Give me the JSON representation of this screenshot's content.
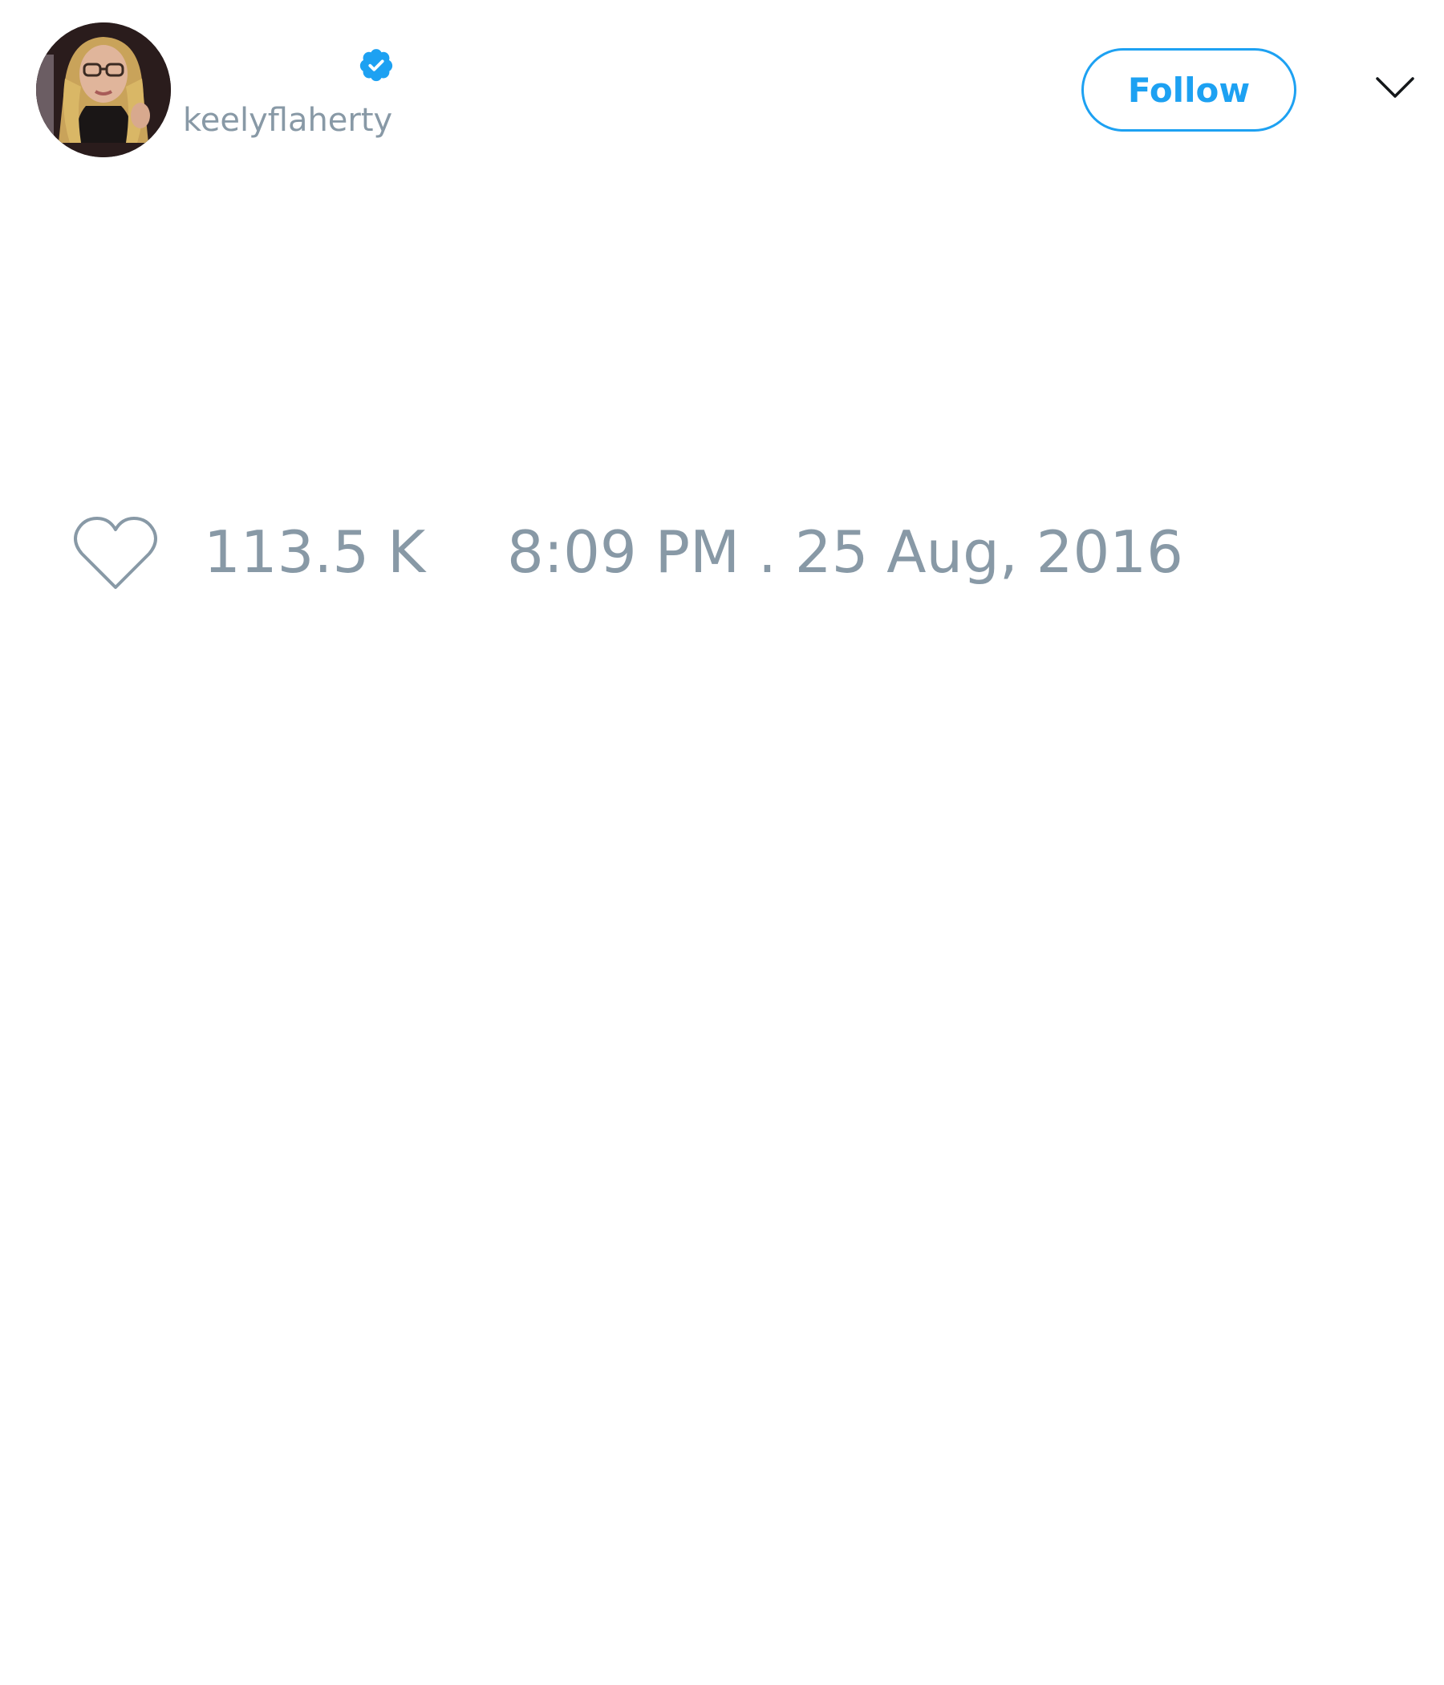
{
  "tweet": {
    "author": {
      "handle": "keelyflaherty",
      "verified": true,
      "avatar_icon": "profile-photo"
    },
    "follow_label": "Follow",
    "menu_icon": "chevron-down-icon",
    "like_icon": "heart-outline-icon",
    "likes": "113.5 K",
    "timestamp": "8:09 PM . 25 Aug, 2016"
  },
  "colors": {
    "accent": "#1da1f2",
    "muted_text": "#8899a6",
    "background": "#ffffff"
  }
}
